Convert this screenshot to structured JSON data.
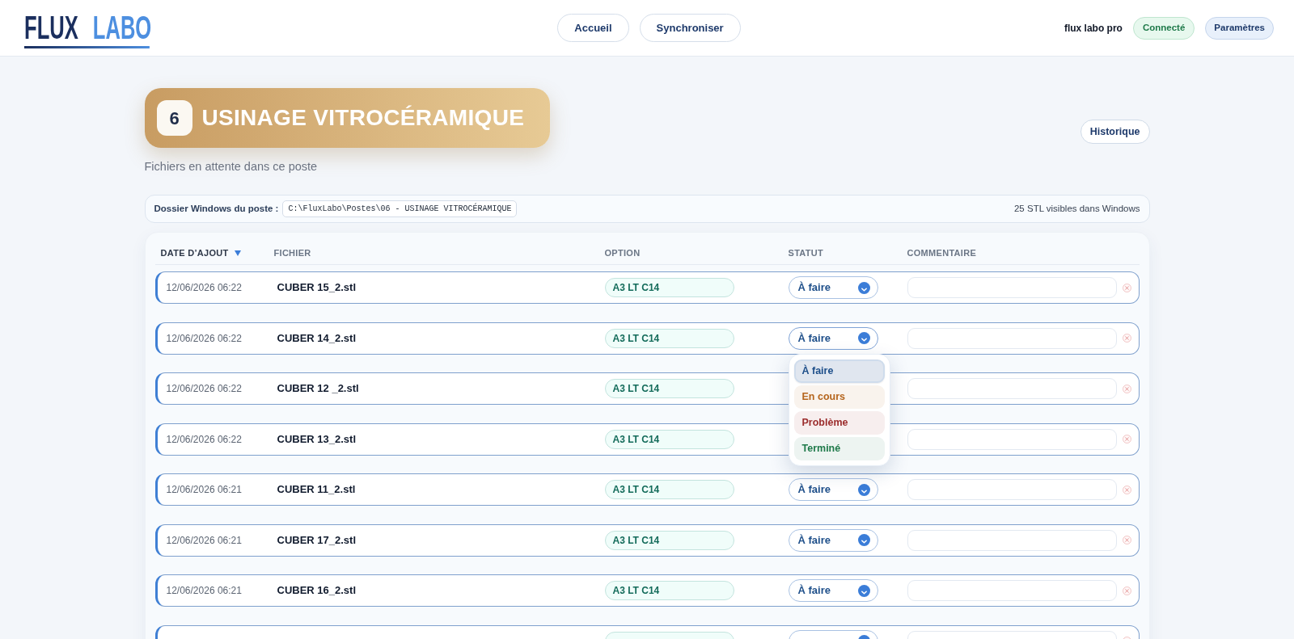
{
  "header": {
    "logo": {
      "part_1": "FLUX",
      "part_2": "LABO"
    },
    "nav": [
      {
        "label": "Accueil"
      },
      {
        "label": "Synchroniser"
      }
    ],
    "user": "flux labo pro",
    "connection_status": "Connecté",
    "settings_button": "Paramètres"
  },
  "station": {
    "number": "6",
    "title": "USINAGE VITROCÉRAMIQUE",
    "subtitle": "Fichiers en attente dans ce poste",
    "history_button": "Historique"
  },
  "folder_bar": {
    "label": "Dossier Windows du poste :",
    "path": "C:\\FluxLabo\\Postes\\06 - USINAGE VITROCÉRAMIQUE",
    "count": "25 STL visibles dans Windows"
  },
  "table": {
    "columns": [
      {
        "label": "DATE D’AJOUT",
        "sorted": true
      },
      {
        "label": "FICHIER",
        "sorted": false
      },
      {
        "label": "OPTION",
        "sorted": false
      },
      {
        "label": "STATUT",
        "sorted": false
      },
      {
        "label": "COMMENTAIRE",
        "sorted": false
      }
    ],
    "rows": [
      {
        "date": "12/06/2026 06:22",
        "file": "CUBER 15_2.stl",
        "option": "A3 LT C14",
        "status": {
          "value": "À faire",
          "expanded": false
        }
      },
      {
        "date": "12/06/2026 06:22",
        "file": "CUBER 14_2.stl",
        "option": "A3 LT C14",
        "status": {
          "value": "À faire",
          "expanded": true,
          "options": [
            {
              "label": "À faire",
              "selected": true,
              "color": "#1e4f8a"
            },
            {
              "label": "En cours",
              "selected": false,
              "color": "#b5651d"
            },
            {
              "label": "Problème",
              "selected": false,
              "color": "#9b2c2c"
            },
            {
              "label": "Terminé",
              "selected": false,
              "color": "#1f7a4a"
            }
          ]
        }
      },
      {
        "date": "12/06/2026 06:22",
        "file": "CUBER 12 _2.stl",
        "option": "A3 LT C14"
      },
      {
        "date": "12/06/2026 06:22",
        "file": "CUBER 13_2.stl",
        "option": "A3 LT C14"
      },
      {
        "date": "12/06/2026 06:21",
        "file": "CUBER 11_2.stl",
        "option": "A3 LT C14",
        "status": {
          "value": "À faire",
          "expanded": false
        }
      },
      {
        "date": "12/06/2026 06:21",
        "file": "CUBER 17_2.stl",
        "option": "A3 LT C14",
        "status": {
          "value": "À faire",
          "expanded": false
        }
      },
      {
        "date": "12/06/2026 06:21",
        "file": "CUBER 16_2.stl",
        "option": "A3 LT C14",
        "status": {
          "value": "À faire",
          "expanded": false
        }
      },
      {
        "status": {
          "expanded": false
        }
      }
    ]
  }
}
